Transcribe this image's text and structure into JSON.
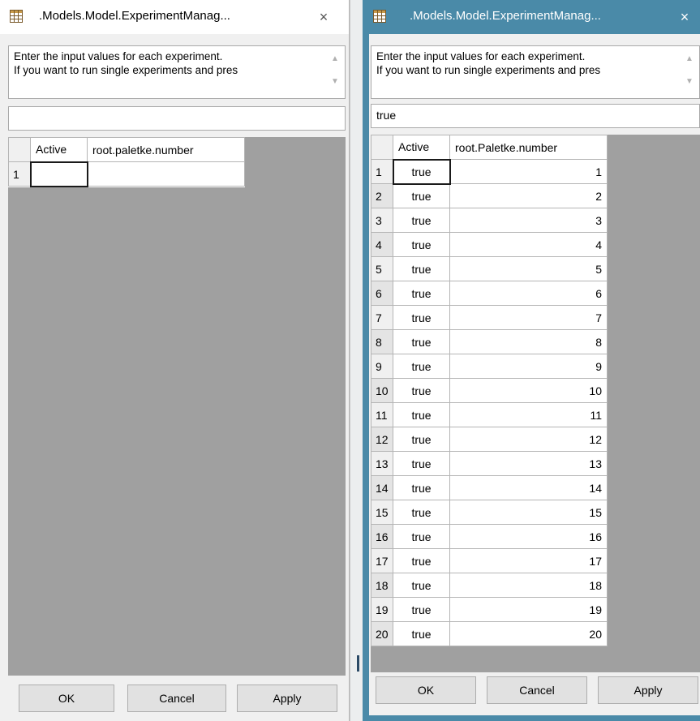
{
  "left_window": {
    "title": ".Models.Model.ExperimentManag...",
    "close_glyph": "×",
    "description_line1": "Enter the input values for each experiment.",
    "description_line2": "If you want to run single experiments and pres",
    "value_box": "",
    "columns": [
      "Active",
      "root.paletke.number"
    ],
    "rows": [
      {
        "index": "1",
        "active": "",
        "number": ""
      }
    ],
    "buttons": {
      "ok": "OK",
      "cancel": "Cancel",
      "apply": "Apply"
    }
  },
  "right_window": {
    "title": ".Models.Model.ExperimentManag...",
    "close_glyph": "×",
    "description_line1": "Enter the input values for each experiment.",
    "description_line2": "If you want to run single experiments and pres",
    "value_box": "true",
    "columns": [
      "Active",
      "root.Paletke.number"
    ],
    "rows": [
      {
        "index": "1",
        "active": "true",
        "number": "1"
      },
      {
        "index": "2",
        "active": "true",
        "number": "2"
      },
      {
        "index": "3",
        "active": "true",
        "number": "3"
      },
      {
        "index": "4",
        "active": "true",
        "number": "4"
      },
      {
        "index": "5",
        "active": "true",
        "number": "5"
      },
      {
        "index": "6",
        "active": "true",
        "number": "6"
      },
      {
        "index": "7",
        "active": "true",
        "number": "7"
      },
      {
        "index": "8",
        "active": "true",
        "number": "8"
      },
      {
        "index": "9",
        "active": "true",
        "number": "9"
      },
      {
        "index": "10",
        "active": "true",
        "number": "10"
      },
      {
        "index": "11",
        "active": "true",
        "number": "11"
      },
      {
        "index": "12",
        "active": "true",
        "number": "12"
      },
      {
        "index": "13",
        "active": "true",
        "number": "13"
      },
      {
        "index": "14",
        "active": "true",
        "number": "14"
      },
      {
        "index": "15",
        "active": "true",
        "number": "15"
      },
      {
        "index": "16",
        "active": "true",
        "number": "16"
      },
      {
        "index": "17",
        "active": "true",
        "number": "17"
      },
      {
        "index": "18",
        "active": "true",
        "number": "18"
      },
      {
        "index": "19",
        "active": "true",
        "number": "19"
      },
      {
        "index": "20",
        "active": "true",
        "number": "20"
      }
    ],
    "buttons": {
      "ok": "OK",
      "cancel": "Cancel",
      "apply": "Apply"
    }
  },
  "colors": {
    "active_titlebar": "#4a8aa8",
    "grid_background": "#a0a0a0"
  },
  "icons": {
    "window_icon": "grid-table-icon",
    "close": "close-icon",
    "scroll_up": "scroll-up-arrow-icon",
    "scroll_down": "scroll-down-arrow-icon"
  }
}
